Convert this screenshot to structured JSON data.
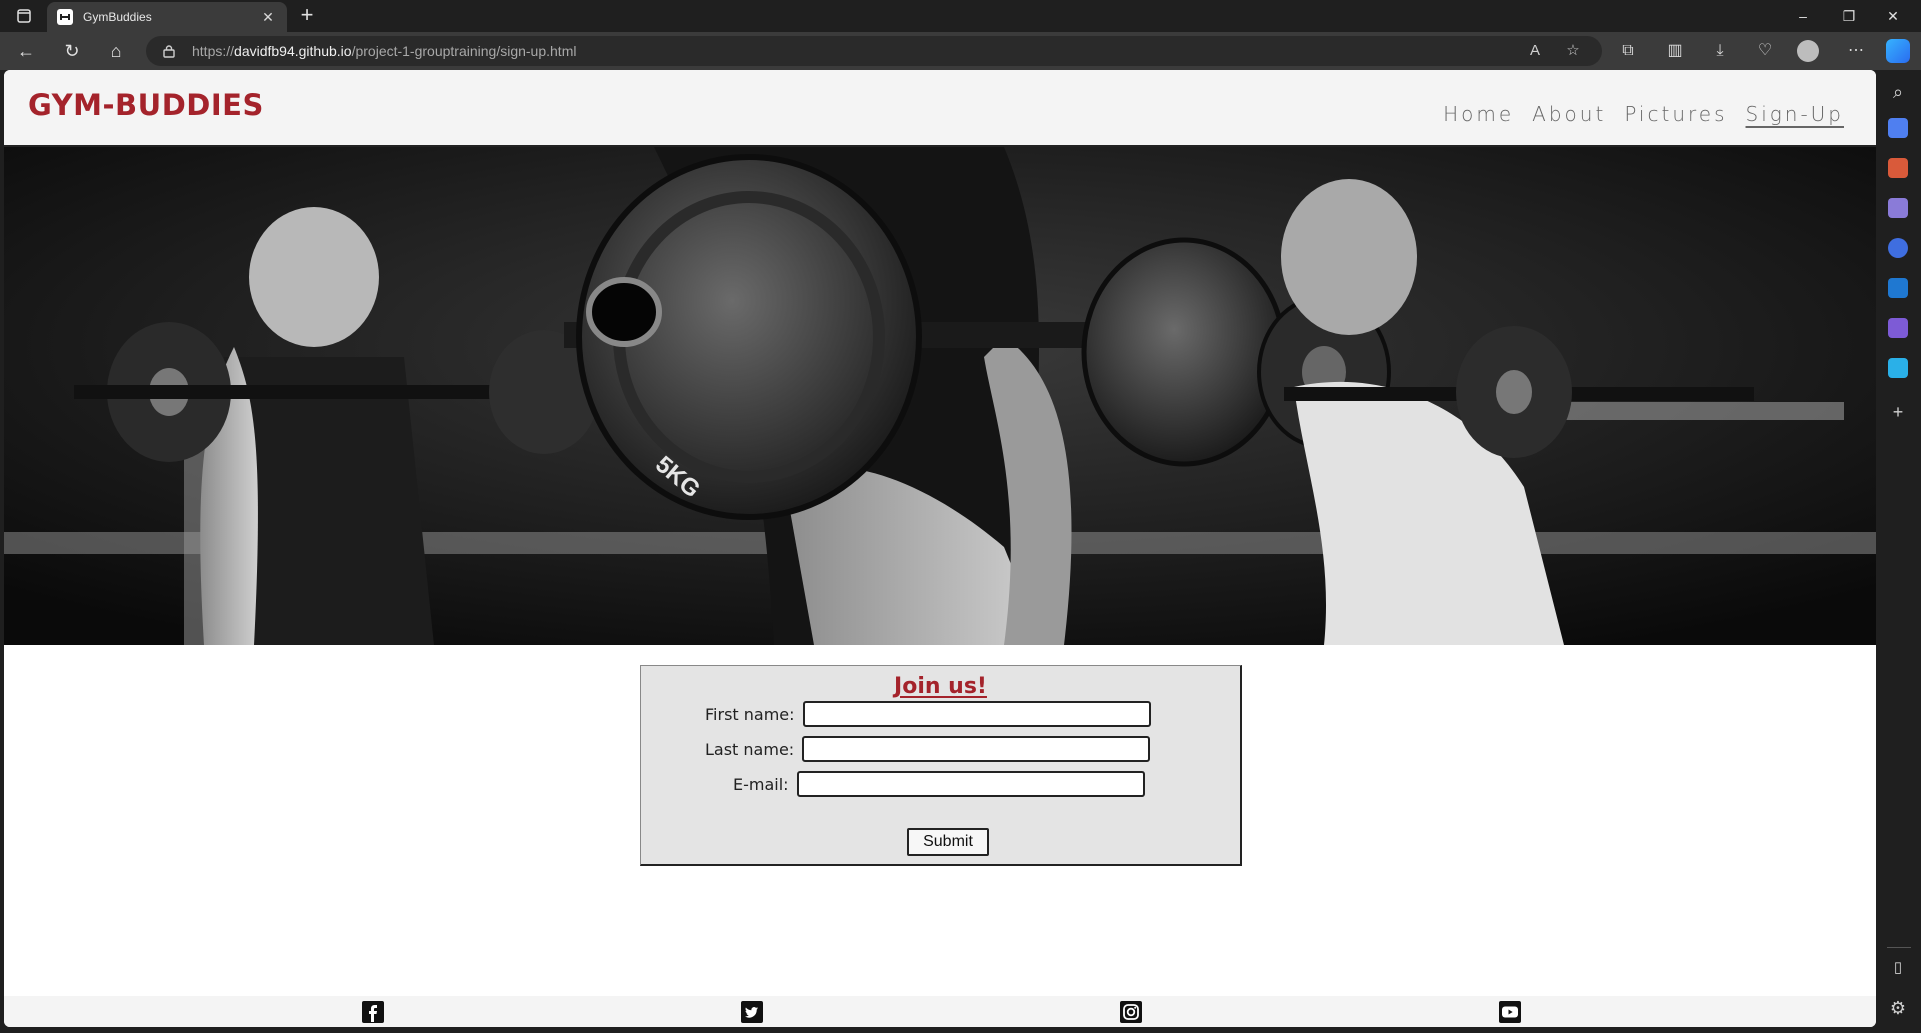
{
  "browser": {
    "tab_title": "GymBuddies",
    "url_scheme": "https://",
    "url_host": "davidfb94.github.io",
    "url_path": "/project-1-grouptraining/sign-up.html"
  },
  "site": {
    "logo": "GYM-BUDDIES",
    "nav": [
      {
        "label": "Home"
      },
      {
        "label": "About"
      },
      {
        "label": "Pictures"
      },
      {
        "label": "Sign-Up",
        "active": true
      }
    ],
    "hero_plate_label": "5KG",
    "form": {
      "title": "Join us!",
      "first_name_label": "First name:",
      "last_name_label": "Last name:",
      "email_label": "E-mail:",
      "first_name_value": "",
      "last_name_value": "",
      "email_value": "",
      "submit_label": "Submit"
    },
    "footer_icons": [
      "facebook-icon",
      "twitter-icon",
      "instagram-icon",
      "youtube-icon"
    ]
  },
  "colors": {
    "brand": "#a4232b",
    "header_bg": "#f4f4f4",
    "form_bg": "#e4e4e4"
  }
}
